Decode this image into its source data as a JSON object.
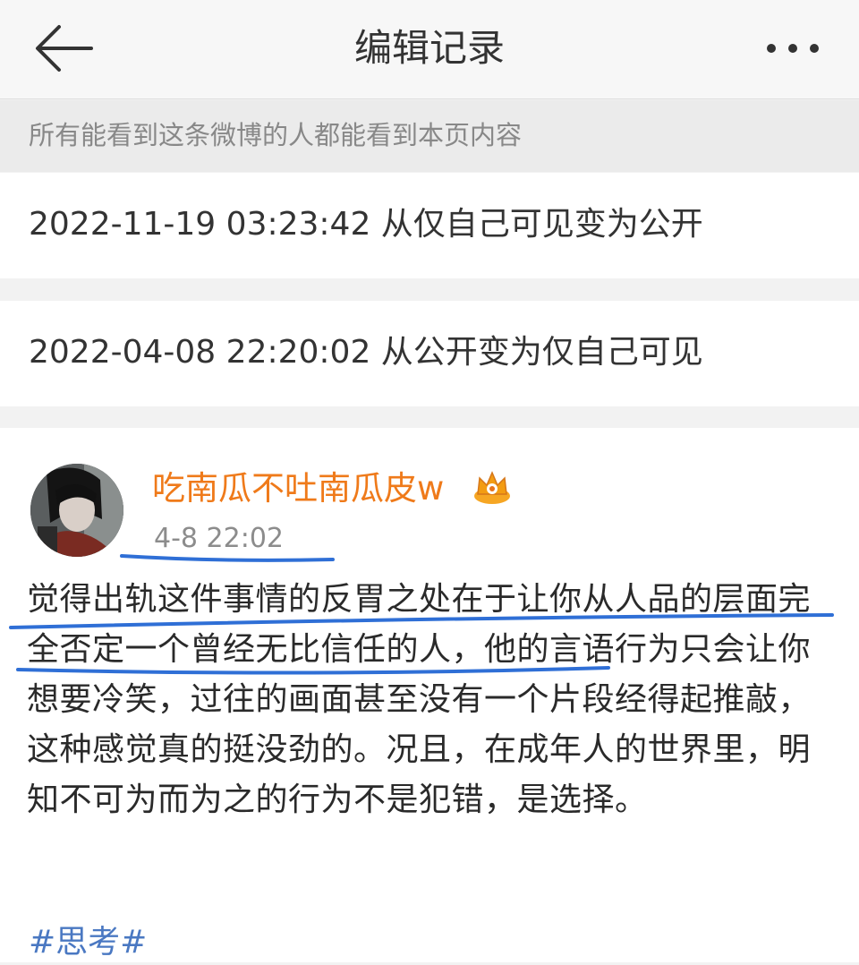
{
  "header": {
    "title": "编辑记录",
    "back_icon": "arrow-left-icon",
    "more_icon": "more-horizontal-icon"
  },
  "notice": "所有能看到这条微博的人都能看到本页内容",
  "records": [
    {
      "text": "2022-11-19 03:23:42 从仅自己可见变为公开"
    },
    {
      "text": "2022-04-08 22:20:02 从公开变为仅自己可见"
    }
  ],
  "post": {
    "username": "吃南瓜不吐南瓜皮w",
    "badge_icon": "crown-vip-icon",
    "time": "4-8 22:02",
    "content": "觉得出轨这件事情的反胃之处在于让你从人品的层面完全否定一个曾经无比信任的人，他的言语行为只会让你想要冷笑，过往的画面甚至没有一个片段经得起推敲，这种感觉真的挺没劲的。况且，在成年人的世界里，明知不可为而为之的行为不是犯错，是选择。",
    "hashtag": "#思考#"
  },
  "colors": {
    "username": "#ef7a1a",
    "hashtag": "#4a78c2",
    "underline": "#2f6fd6"
  }
}
